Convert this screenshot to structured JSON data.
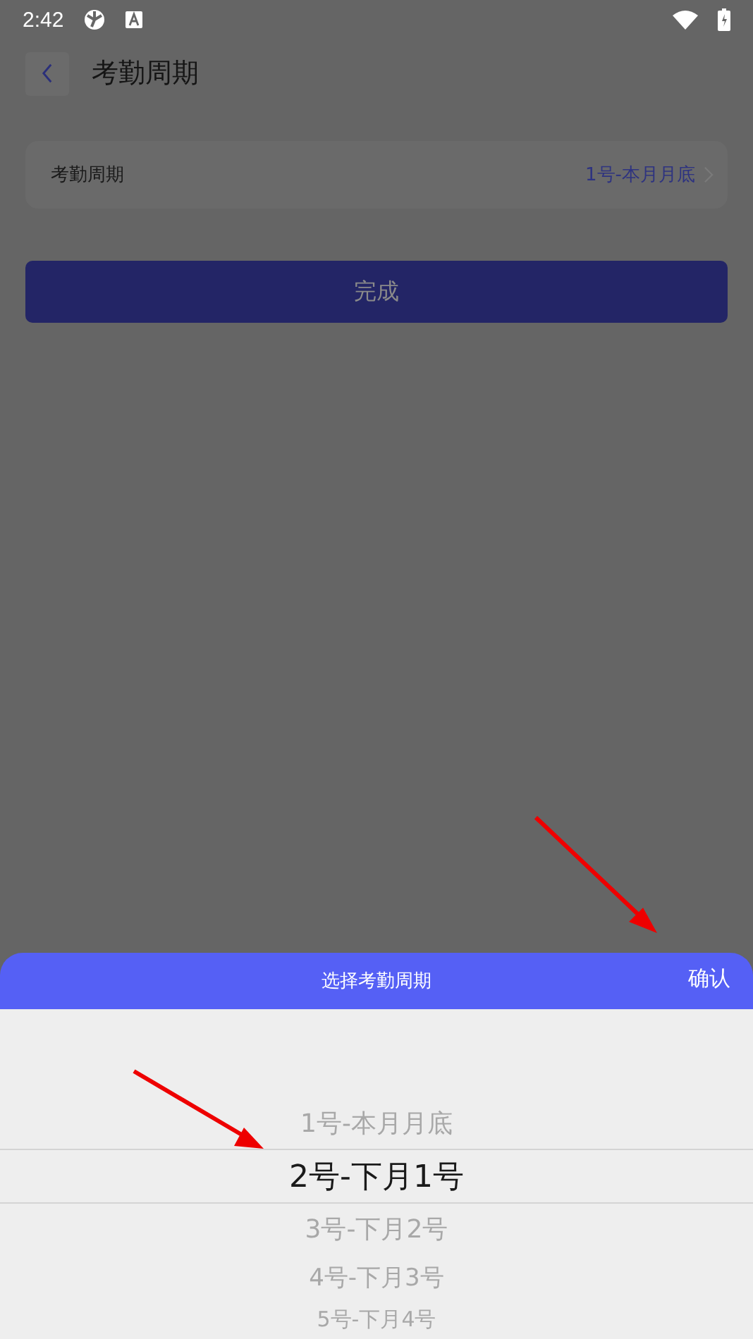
{
  "status_bar": {
    "time": "2:42"
  },
  "header": {
    "title": "考勤周期"
  },
  "setting_row": {
    "label": "考勤周期",
    "value": "1号-本月月底"
  },
  "done_button": {
    "label": "完成",
    "disabled": true
  },
  "picker_sheet": {
    "title": "选择考勤周期",
    "confirm": "确认",
    "options": [
      {
        "label": "1号-本月月底",
        "selected": false
      },
      {
        "label": "2号-下月1号",
        "selected": true
      },
      {
        "label": "3号-下月2号",
        "selected": false
      },
      {
        "label": "4号-下月3号",
        "selected": false
      },
      {
        "label": "5号-下月4号",
        "selected": false
      }
    ]
  }
}
